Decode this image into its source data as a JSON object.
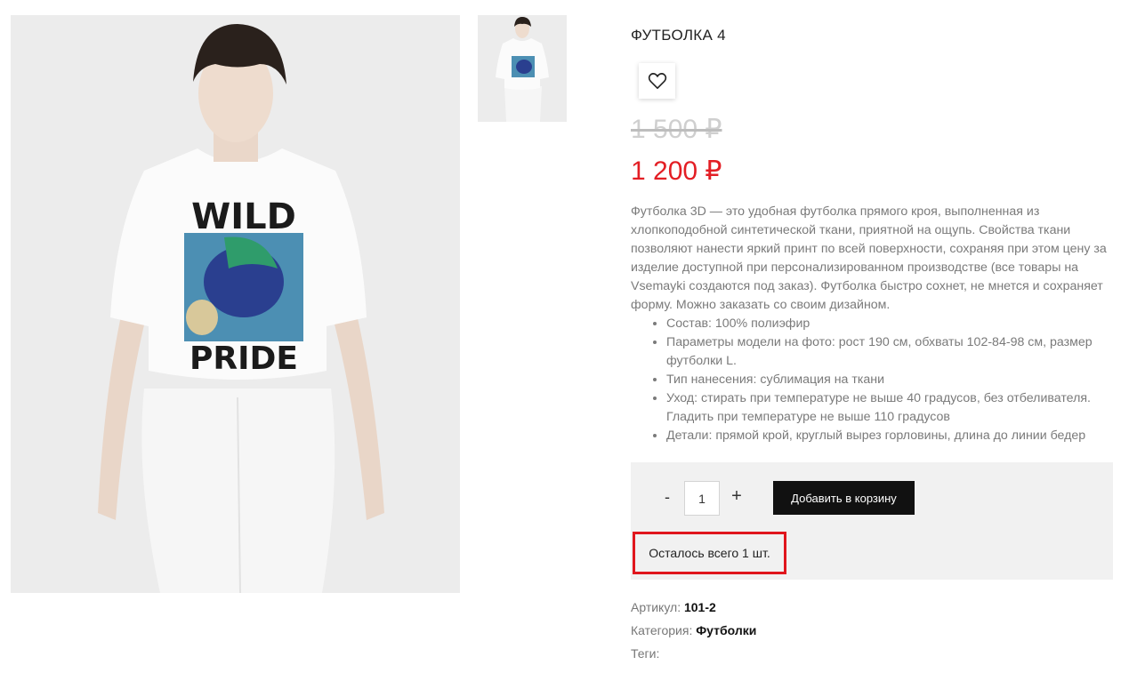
{
  "product": {
    "title": "ФУТБОЛКА 4",
    "old_price": "1 500 ₽",
    "new_price": "1 200 ₽",
    "description": "Футболка 3D — это удобная футболка прямого кроя, выполненная из хлопкоподобной синтетической ткани, приятной на ощупь. Свойства ткани позволяют нанести яркий принт по всей поверхности, сохраняя при этом цену за изделие доступной при персонализированном производстве (все товары на Vsemayki создаются под заказ). Футболка быстро сохнет, не мнется и сохраняет форму. Можно заказать со своим дизайном.",
    "specs": [
      "Состав: 100% полиэфир",
      "Параметры модели на фото: рост 190 см, обхваты 102-84-98 см, размер футболки L.",
      "Тип нанесения: сублимация на ткани",
      "Уход: стирать при температуре не выше 40 градусов, без отбеливателя. Гладить при температуре не выше 110 градусов",
      "Детали: прямой крой, круглый вырез горловины, длина до линии бедер"
    ],
    "print_text": "WILD"
  },
  "cart": {
    "minus": "-",
    "quantity": "1",
    "plus": "+",
    "add_button": "Добавить в корзину",
    "stock_note": "Осталось всего 1 шт."
  },
  "meta": {
    "sku_label": "Артикул:",
    "sku_value": "101-2",
    "category_label": "Категория:",
    "category_value": "Футболки",
    "tags_label": "Теги:"
  },
  "icons": {
    "wishlist": "heart-icon"
  },
  "colors": {
    "price_red": "#e31e24",
    "highlight_red": "#e0161d",
    "button_black": "#111111",
    "buy_box_bg": "#f1f1f1"
  }
}
